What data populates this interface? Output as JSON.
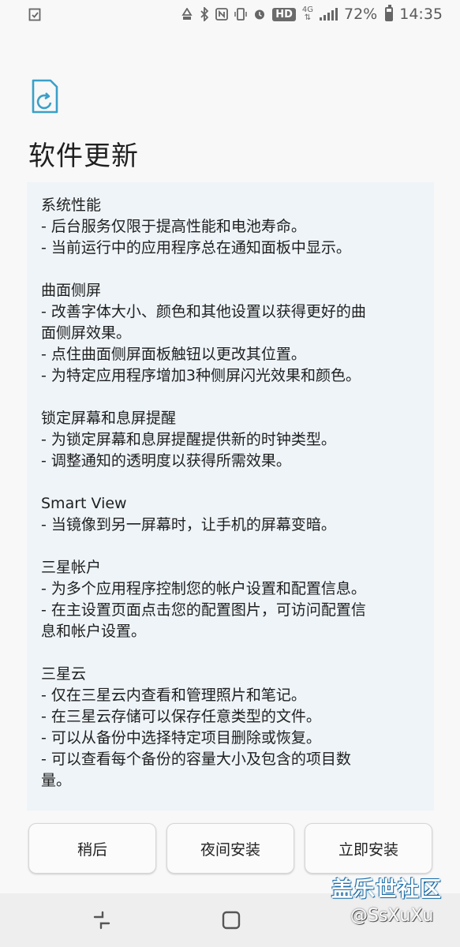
{
  "status_bar": {
    "network_type": "4G",
    "hd_label": "HD",
    "battery": "72%",
    "battery_level": 0.72,
    "time": "14:35"
  },
  "page": {
    "title": "软件更新"
  },
  "release_notes": [
    {
      "title": "系统性能",
      "lines": [
        "- 后台服务仅限于提高性能和电池寿命。",
        "- 当前运行中的应用程序总在通知面板中显示。"
      ]
    },
    {
      "title": "曲面侧屏",
      "lines": [
        "- 改善字体大小、颜色和其他设置以获得更好的曲",
        "面侧屏效果。",
        "- 点住曲面侧屏面板触钮以更改其位置。",
        "- 为特定应用程序增加3种侧屏闪光效果和颜色。"
      ]
    },
    {
      "title": "锁定屏幕和息屏提醒",
      "lines": [
        "- 为锁定屏幕和息屏提醒提供新的时钟类型。",
        "- 调整通知的透明度以获得所需效果。"
      ]
    },
    {
      "title": "Smart View",
      "lines": [
        "- 当镜像到另一屏幕时，让手机的屏幕变暗。"
      ]
    },
    {
      "title": "三星帐户",
      "lines": [
        "- 为多个应用程序控制您的帐户设置和配置信息。",
        "- 在主设置页面点击您的配置图片，可访问配置信",
        "息和帐户设置。"
      ]
    },
    {
      "title": "三星云",
      "lines": [
        "- 仅在三星云内查看和管理照片和笔记。",
        "- 在三星云存储可以保存任意类型的文件。",
        "- 可以从备份中选择特定项目删除或恢复。",
        "- 可以查看每个备份的容量大小及包含的项目数",
        "量。"
      ]
    }
  ],
  "buttons": {
    "later": "稍后",
    "overnight": "夜间安装",
    "install_now": "立即安装"
  },
  "watermark": {
    "site": "盖乐世社区",
    "user": "@SsXuXu"
  },
  "colors": {
    "accent": "#3aa0c8",
    "notes_background": "#eef4f8"
  }
}
